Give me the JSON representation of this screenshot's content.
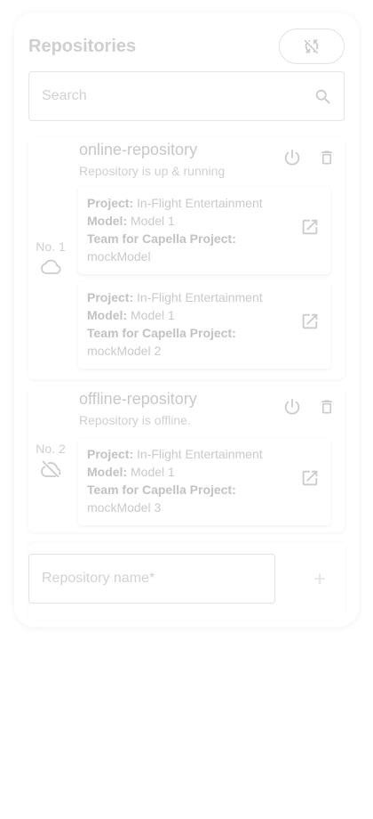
{
  "header": {
    "title": "Repositories",
    "sync_icon": "sync-disabled-icon"
  },
  "search": {
    "placeholder": "Search",
    "value": ""
  },
  "repositories": [
    {
      "number": "No. 1",
      "name": "online-repository",
      "status": "Repository is up & running",
      "cloud_icon": "cloud-icon",
      "models": [
        {
          "project_label": "Project:",
          "project": "In-Flight Entertainment",
          "model_label": "Model:",
          "model": "Model 1",
          "team_label": "Team for Capella Project:",
          "team": "mockModel"
        },
        {
          "project_label": "Project:",
          "project": "In-Flight Entertainment",
          "model_label": "Model:",
          "model": "Model 1",
          "team_label": "Team for Capella Project:",
          "team": "mockModel 2"
        }
      ]
    },
    {
      "number": "No. 2",
      "name": "offline-repository",
      "status": "Repository is offline.",
      "cloud_icon": "cloud-off-icon",
      "models": [
        {
          "project_label": "Project:",
          "project": "In-Flight Entertainment",
          "model_label": "Model:",
          "model": "Model 1",
          "team_label": "Team for Capella Project:",
          "team": "mockModel 3"
        }
      ]
    }
  ],
  "new_repository": {
    "placeholder": "Repository name*",
    "value": ""
  },
  "colors": {
    "icon": "#cccccc",
    "border": "#e2e2e2",
    "text": "#c8c8c8"
  }
}
